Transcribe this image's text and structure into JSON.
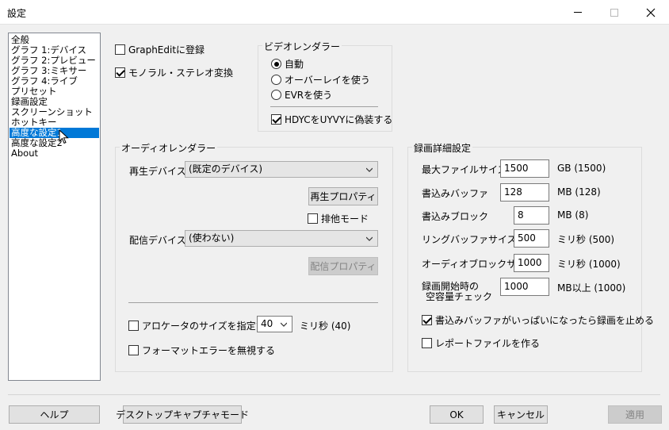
{
  "window": {
    "title": "設定"
  },
  "nav": {
    "items": [
      "全般",
      "グラフ 1:デバイス",
      "グラフ 2:プレビュー",
      "グラフ 3:ミキサー",
      "グラフ 4:ライブ",
      "プリセット",
      "録画設定",
      "スクリーンショット",
      "ホットキー",
      "高度な設定1",
      "高度な設定2",
      "About"
    ],
    "selected_index": 9
  },
  "top": {
    "graphedit_label": "GraphEditに登録",
    "graphedit_checked": false,
    "mono_stereo_label": "モノラル・ステレオ変換",
    "mono_stereo_checked": true
  },
  "video_renderer": {
    "legend": "ビデオレンダラー",
    "options": [
      "自動",
      "オーバーレイを使う",
      "EVRを使う"
    ],
    "selected": "自動",
    "hdyc_label": "HDYCをUYVYに偽装する",
    "hdyc_checked": true
  },
  "audio_renderer": {
    "legend": "オーディオレンダラー",
    "playback_device_label": "再生デバイス",
    "playback_device_value": "(既定のデバイス)",
    "playback_props_button": "再生プロパティ",
    "exclusive_label": "排他モード",
    "exclusive_checked": false,
    "stream_device_label": "配信デバイス",
    "stream_device_value": "(使わない)",
    "stream_props_button": "配信プロパティ",
    "allocator_label": "アロケータのサイズを指定する",
    "allocator_checked": false,
    "allocator_value": "40",
    "allocator_unit": "ミリ秒 (40)",
    "format_error_label": "フォーマットエラーを無視する",
    "format_error_checked": false
  },
  "recording": {
    "legend": "録画詳細設定",
    "rows": [
      {
        "label": "最大ファイルサイズ",
        "value": "1500",
        "unit": "GB (1500)"
      },
      {
        "label": "書込みバッファ",
        "value": "128",
        "unit": "MB (128)"
      },
      {
        "label": "書込みブロック",
        "value": "8",
        "unit": "MB (8)"
      },
      {
        "label": "リングバッファサイズ",
        "value": "500",
        "unit": "ミリ秒 (500)"
      },
      {
        "label": "オーディオブロックサイズ",
        "value": "1000",
        "unit": "ミリ秒 (1000)"
      }
    ],
    "free_space_label_1": "録画開始時の",
    "free_space_label_2": "空容量チェック",
    "free_space_value": "1000",
    "free_space_unit": "MB以上 (1000)",
    "stop_when_full_label": "書込みバッファがいっぱいになったら録画を止める",
    "stop_when_full_checked": true,
    "report_file_label": "レポートファイルを作る",
    "report_file_checked": false
  },
  "footer": {
    "help": "ヘルプ",
    "desktop_capture": "デスクトップキャプチャモード",
    "ok": "OK",
    "cancel": "キャンセル",
    "apply": "適用"
  }
}
